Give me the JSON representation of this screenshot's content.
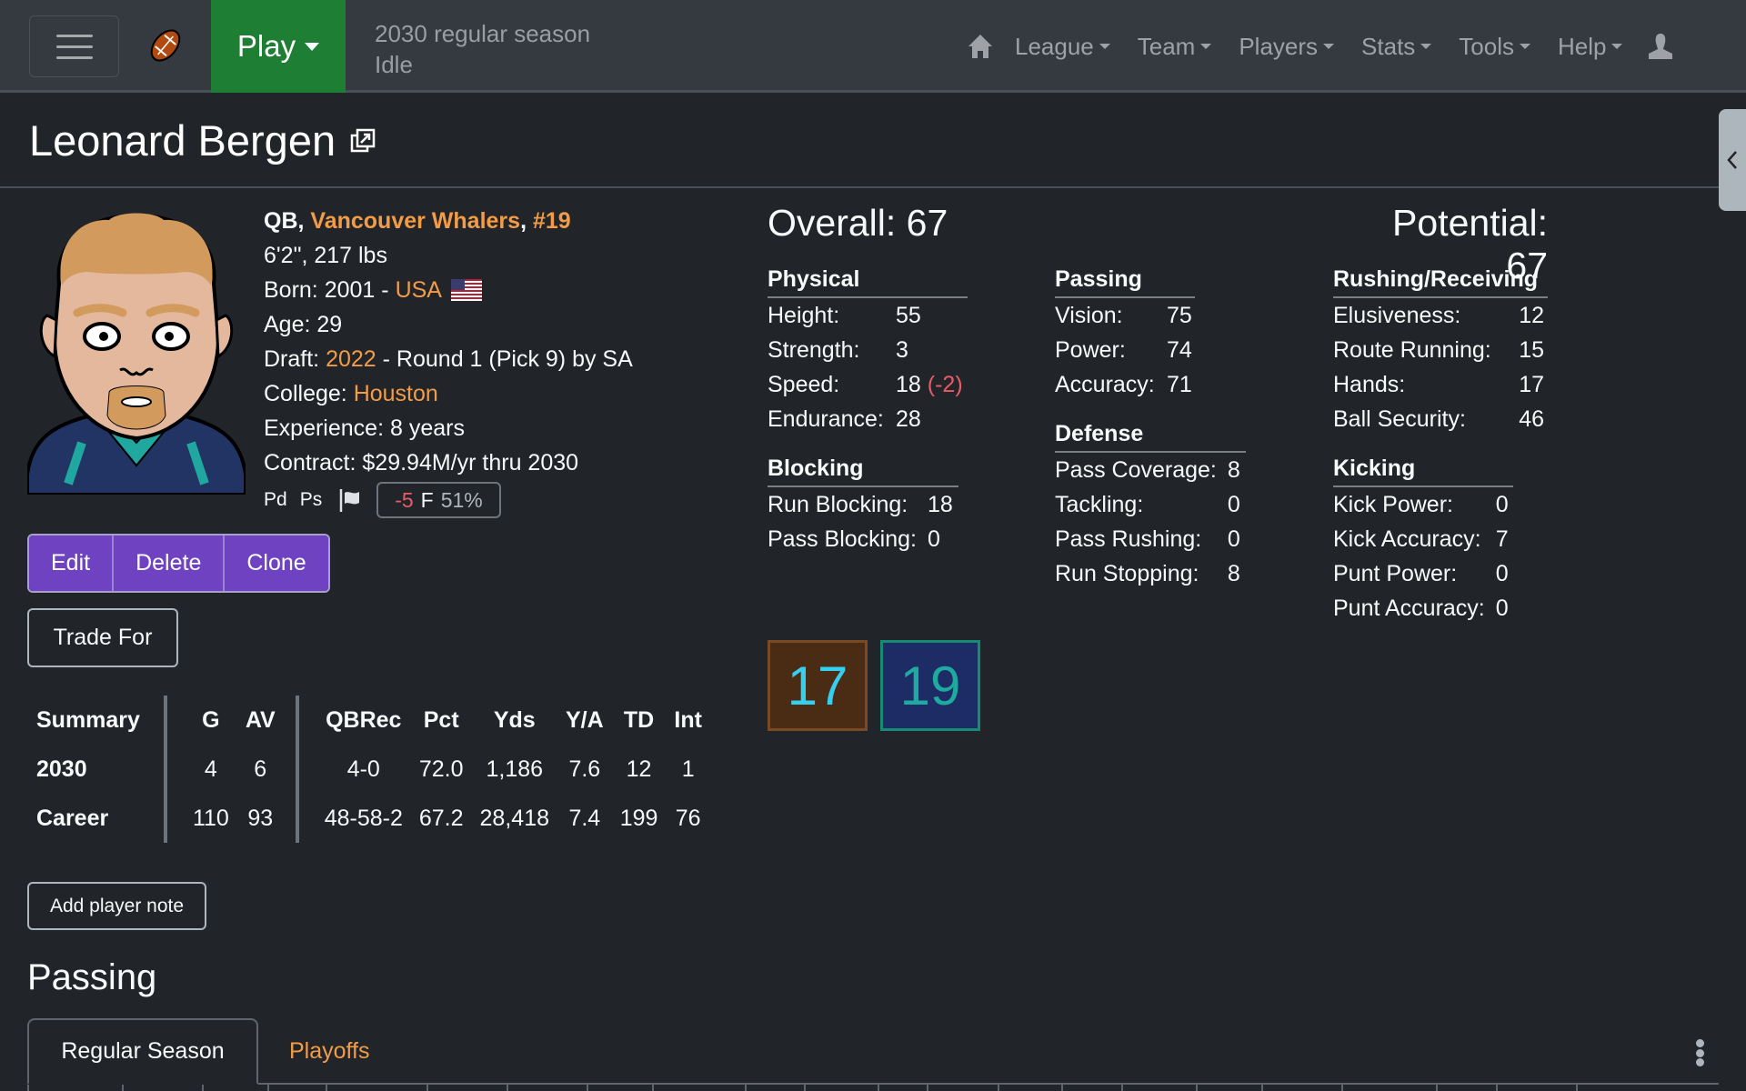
{
  "navbar": {
    "menu_icon": "hamburger-icon",
    "logo_icon": "football-icon",
    "play_label": "Play",
    "season_line1": "2030 regular season",
    "season_line2": "Idle",
    "home_icon": "home-icon",
    "items": [
      {
        "label": "League"
      },
      {
        "label": "Team"
      },
      {
        "label": "Players"
      },
      {
        "label": "Stats"
      },
      {
        "label": "Tools"
      },
      {
        "label": "Help"
      }
    ],
    "user_icon": "user-icon"
  },
  "player": {
    "name": "Leonard Bergen",
    "position": "QB",
    "team": "Vancouver Whalers",
    "jersey": "#19",
    "height_weight": "6'2\", 217 lbs",
    "born_label": "Born:",
    "born_year": "2001",
    "born_country": "USA",
    "age_label": "Age:",
    "age": "29",
    "draft_label": "Draft:",
    "draft_year": "2022",
    "draft_detail": "- Round 1 (Pick 9) by SA",
    "college_label": "College:",
    "college": "Houston",
    "experience_label": "Experience:",
    "experience": "8 years",
    "contract_label": "Contract:",
    "contract": "$29.94M/yr thru 2030",
    "skills": [
      "Pd",
      "Ps"
    ],
    "mood_change": "-5",
    "mood_grade": "F",
    "mood_pct": "51%"
  },
  "actions": {
    "edit": "Edit",
    "delete": "Delete",
    "clone": "Clone",
    "trade_for": "Trade For",
    "add_note": "Add player note"
  },
  "summary": {
    "headers": [
      "Summary",
      "G",
      "AV",
      "QBRec",
      "Pct",
      "Yds",
      "Y/A",
      "TD",
      "Int"
    ],
    "rows": [
      {
        "label": "2030",
        "cells": [
          "4",
          "6",
          "4-0",
          "72.0",
          "1,186",
          "7.6",
          "12",
          "1"
        ]
      },
      {
        "label": "Career",
        "cells": [
          "110",
          "93",
          "48-58-2",
          "67.2",
          "28,418",
          "7.4",
          "199",
          "76"
        ]
      }
    ]
  },
  "ratings": {
    "overall": "Overall: 67",
    "potential": "Potential: 67",
    "physical": {
      "title": "Physical",
      "items": [
        {
          "label": "Height:",
          "value": "55"
        },
        {
          "label": "Strength:",
          "value": "3"
        },
        {
          "label": "Speed:",
          "value": "18",
          "change": "(-2)"
        },
        {
          "label": "Endurance:",
          "value": "28"
        }
      ]
    },
    "blocking": {
      "title": "Blocking",
      "items": [
        {
          "label": "Run Blocking:",
          "value": "18"
        },
        {
          "label": "Pass Blocking:",
          "value": "0"
        }
      ]
    },
    "passing": {
      "title": "Passing",
      "items": [
        {
          "label": "Vision:",
          "value": "75"
        },
        {
          "label": "Power:",
          "value": "74"
        },
        {
          "label": "Accuracy:",
          "value": "71"
        }
      ]
    },
    "defense": {
      "title": "Defense",
      "items": [
        {
          "label": "Pass Coverage:",
          "value": "8"
        },
        {
          "label": "Tackling:",
          "value": "0"
        },
        {
          "label": "Pass Rushing:",
          "value": "0"
        },
        {
          "label": "Run Stopping:",
          "value": "8"
        }
      ]
    },
    "rushing": {
      "title": "Rushing/Receiving",
      "items": [
        {
          "label": "Elusiveness:",
          "value": "12"
        },
        {
          "label": "Route Running:",
          "value": "15"
        },
        {
          "label": "Hands:",
          "value": "17"
        },
        {
          "label": "Ball Security:",
          "value": "46"
        }
      ]
    },
    "kicking": {
      "title": "Kicking",
      "items": [
        {
          "label": "Kick Power:",
          "value": "0"
        },
        {
          "label": "Kick Accuracy:",
          "value": "7"
        },
        {
          "label": "Punt Power:",
          "value": "0"
        },
        {
          "label": "Punt Accuracy:",
          "value": "0"
        }
      ]
    }
  },
  "jersey_numbers": [
    {
      "number": "17",
      "bg": "#4a2c14",
      "border": "#7a4a26",
      "color": "#35d0f0"
    },
    {
      "number": "19",
      "bg": "#1e2c66",
      "border": "#178a74",
      "color": "#1faaa0"
    }
  ],
  "passing_section": {
    "title": "Passing",
    "tabs": [
      {
        "label": "Regular Season",
        "active": true
      },
      {
        "label": "Playoffs",
        "active": false
      }
    ]
  },
  "colors": {
    "link": "#f39c47",
    "play_button": "#1e7e34",
    "action_buttons": "#6f42c1",
    "negative": "#e85c67"
  }
}
